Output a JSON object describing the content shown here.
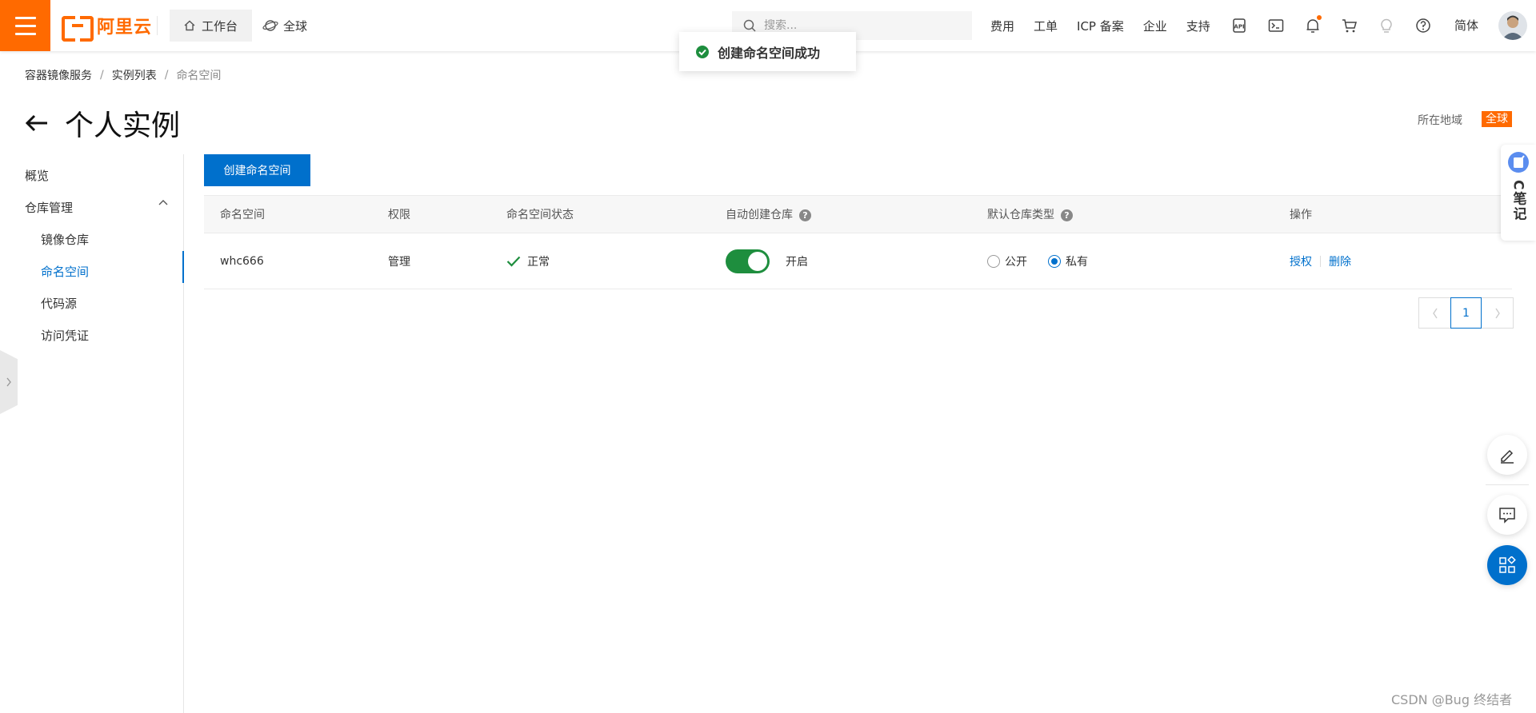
{
  "header": {
    "logo_text": "阿里云",
    "workbench_label": "工作台",
    "region_label": "全球",
    "search_placeholder": "搜索...",
    "links": [
      "费用",
      "工单",
      "ICP 备案",
      "企业",
      "支持"
    ],
    "lang_label": "简体",
    "icons": [
      "api-icon",
      "terminal-icon",
      "bell-icon",
      "cart-icon",
      "lightbulb-icon",
      "help-icon"
    ]
  },
  "toast": {
    "message": "创建命名空间成功",
    "status_color": "#1e8e3e"
  },
  "breadcrumb": {
    "items": [
      "容器镜像服务",
      "实例列表",
      "命名空间"
    ]
  },
  "page": {
    "title": "个人实例",
    "region_label": "所在地域",
    "region_value": "全球"
  },
  "sidebar": {
    "overview": "概览",
    "repo_group": "仓库管理",
    "items": [
      "镜像仓库",
      "命名空间",
      "代码源",
      "访问凭证"
    ],
    "active": "命名空间"
  },
  "main": {
    "create_button": "创建命名空间",
    "columns": [
      "命名空间",
      "权限",
      "命名空间状态",
      "自动创建仓库",
      "默认仓库类型",
      "操作"
    ],
    "rows": [
      {
        "namespace": "whc666",
        "permission": "管理",
        "status": "正常",
        "auto_create": true,
        "auto_create_label": "开启",
        "repo_type_options": [
          "公开",
          "私有"
        ],
        "repo_type_selected": "私有",
        "actions": [
          "授权",
          "删除"
        ]
      }
    ],
    "pagination": {
      "current": "1"
    }
  },
  "notes": {
    "label": "C笔记"
  },
  "watermark": "CSDN @Bug 终结者",
  "colors": {
    "brand": "#ff6a00",
    "primary": "#0070cc",
    "success": "#1e8e3e"
  }
}
